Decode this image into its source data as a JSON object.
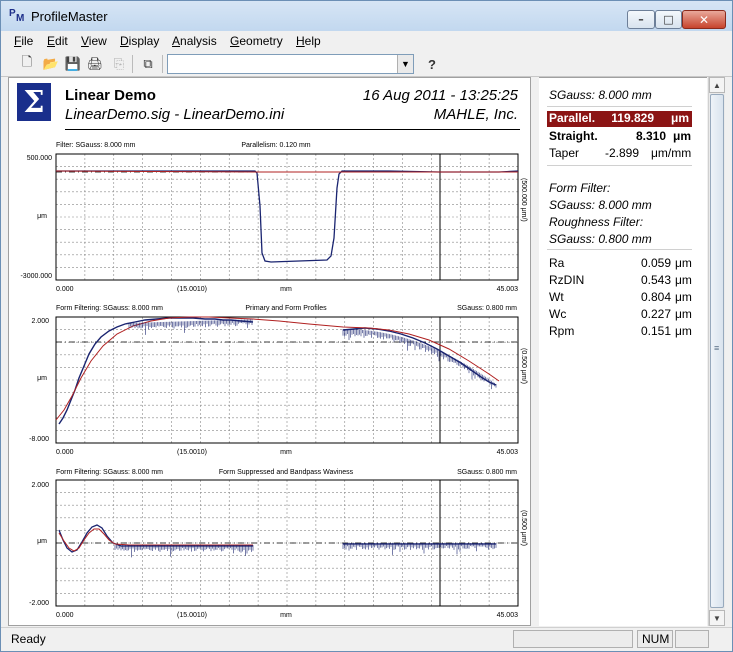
{
  "window": {
    "title": "ProfileMaster",
    "icon_letters": [
      "P",
      "M"
    ]
  },
  "title_buttons": {
    "min": "–",
    "max": "□",
    "close": "✕"
  },
  "menu": [
    "File",
    "Edit",
    "View",
    "Display",
    "Analysis",
    "Geometry",
    "Help"
  ],
  "toolbar": {
    "icons": [
      "new-file-icon",
      "open-folder-icon",
      "save-icon",
      "print-icon",
      "copy-icon",
      "export-icon",
      "help-icon"
    ],
    "glyphs": [
      "🗋",
      "📂",
      "💾",
      "🖨",
      "⎘",
      "⧉",
      "?"
    ],
    "combo_value": "",
    "combo_arrow": "▼"
  },
  "header": {
    "logo": "Σ",
    "title": "Linear Demo",
    "files": "LinearDemo.sig  -  LinearDemo.ini",
    "datetime": "16 Aug 2011 - 13:25:25",
    "company": "MAHLE, Inc."
  },
  "plots": [
    {
      "title_left": "Filter: SGauss: 8.000 mm",
      "title_center": "Parallelism: 0.120 mm",
      "title_right": "",
      "y_top": "500.000",
      "y_mid": "μm",
      "y_bot": "-3000.000",
      "x_left": "0.000",
      "x_mid": "(15.0010)",
      "x_unit": "mm",
      "x_right": "45.003",
      "right_scale": "(500.000 μm/)"
    },
    {
      "title_left": "Form Filtering: SGauss: 8.000 mm",
      "title_center": "Primary and Form Profiles",
      "title_right": "SGauss: 0.800 mm",
      "y_top": "2.000",
      "y_mid": "μm",
      "y_bot": "-8.000",
      "x_left": "0.000",
      "x_mid": "(15.0010)",
      "x_unit": "mm",
      "x_right": "45.003",
      "right_scale": "(0.500 μm/)"
    },
    {
      "title_left": "Form Filtering: SGauss: 8.000 mm",
      "title_center": "Form Suppressed and Bandpass Waviness",
      "title_right": "SGauss: 0.800 mm",
      "y_top": "2.000",
      "y_mid": "μm",
      "y_bot": "-2.000",
      "x_left": "0.000",
      "x_mid": "(15.0010)",
      "x_unit": "mm",
      "x_right": "45.003",
      "right_scale": "(0.500 μm/)"
    }
  ],
  "side": {
    "filter_top": "SGauss: 8.000 mm",
    "parallel": {
      "label": "Parallel.",
      "value": "119.829",
      "unit": "μm"
    },
    "straight": {
      "label": "Straight.",
      "value": "8.310",
      "unit": "μm"
    },
    "taper": {
      "label": "Taper",
      "value": "-2.899",
      "unit": "μm/mm"
    },
    "form_filter_label": "Form Filter:",
    "form_filter_value": "SGauss: 8.000 mm",
    "rough_filter_label": "Roughness Filter:",
    "rough_filter_value": "SGauss: 0.800 mm",
    "params": [
      {
        "label": "Ra",
        "value": "0.059",
        "unit": "μm"
      },
      {
        "label": "RzDIN",
        "value": "0.543",
        "unit": "μm"
      },
      {
        "label": "Wt",
        "value": "0.804",
        "unit": "μm"
      },
      {
        "label": "Wc",
        "value": "0.227",
        "unit": "μm"
      },
      {
        "label": "Rpm",
        "value": "0.151",
        "unit": "μm"
      }
    ]
  },
  "scroll": {
    "up": "▲",
    "down": "▼",
    "grip": "≡"
  },
  "status": {
    "text": "Ready",
    "num": "NUM"
  },
  "colors": {
    "raw": "#1a2470",
    "fit": "#b02020",
    "logo": "#1a2f8c",
    "highlight": "#8b1414"
  }
}
